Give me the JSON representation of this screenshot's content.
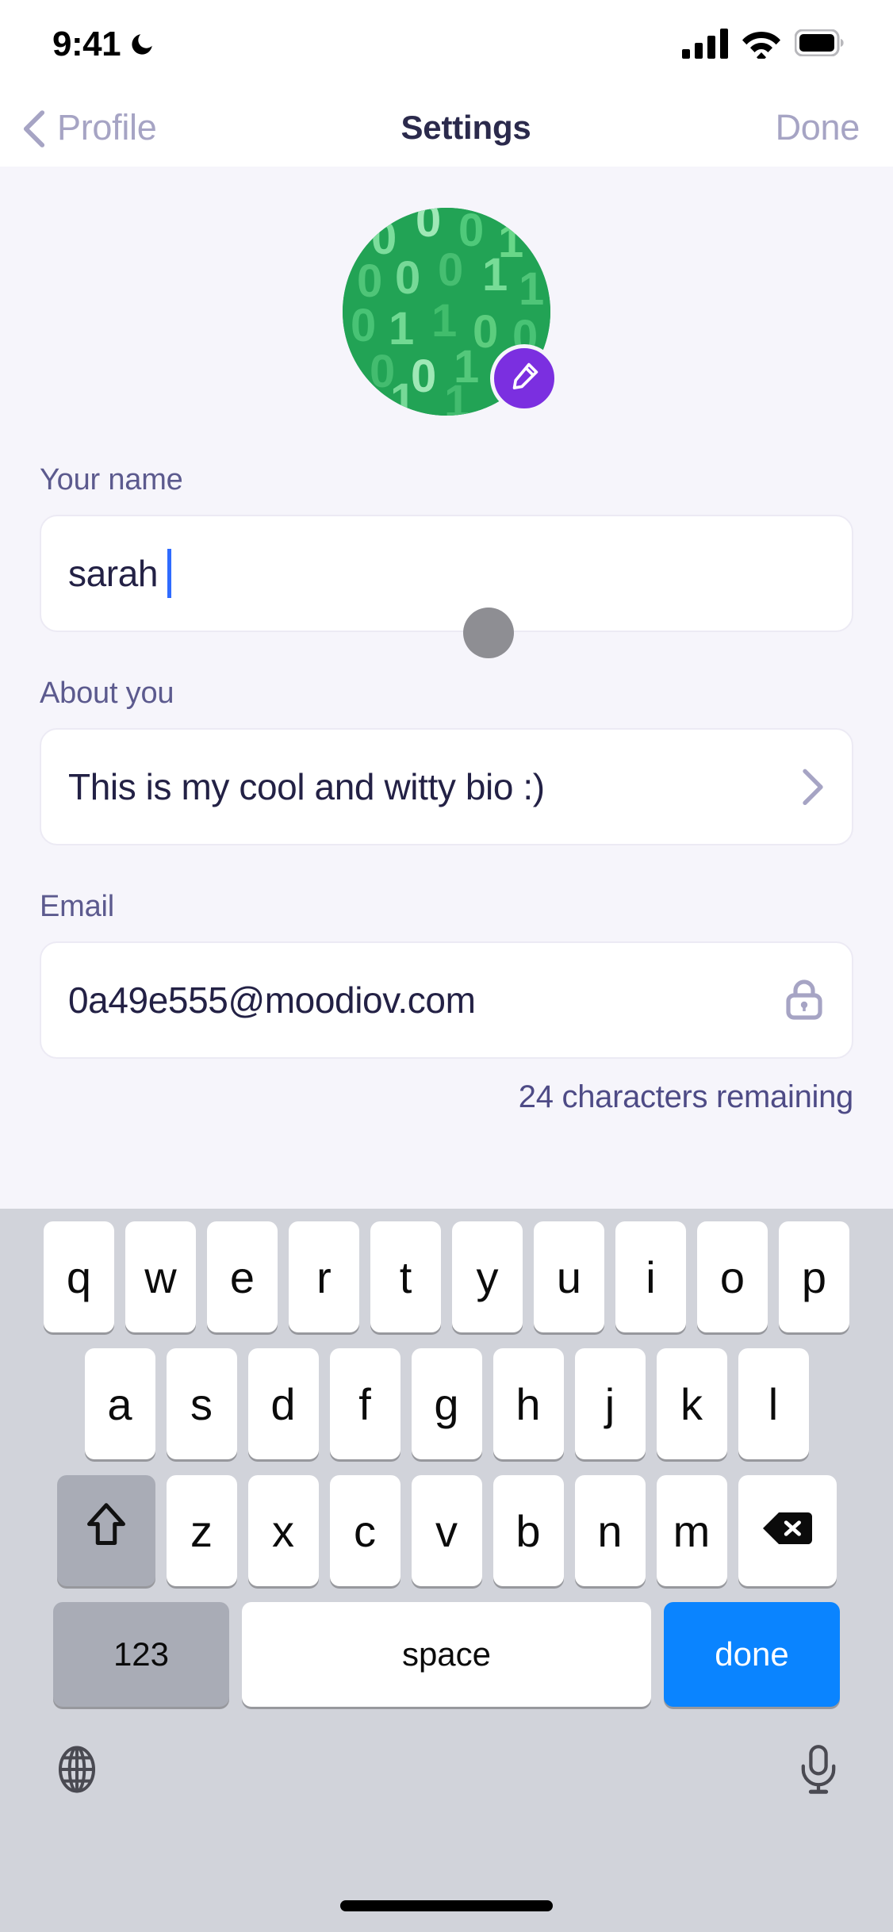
{
  "status_bar": {
    "time": "9:41",
    "icons": [
      "moon-icon",
      "cellular-signal-icon",
      "wifi-icon",
      "battery-icon"
    ]
  },
  "nav": {
    "back_label": "Profile",
    "title": "Settings",
    "done_label": "Done"
  },
  "avatar": {
    "alt": "binary-pattern-avatar",
    "background_color": "#22A355",
    "digit_color": "#7BE495",
    "digits": [
      "0",
      "0",
      "0",
      "1",
      "0",
      "0",
      "1",
      "0",
      "1",
      "1",
      "0",
      "1",
      "1",
      "0",
      "0",
      "1",
      "0",
      "1",
      "0",
      "1"
    ],
    "edit_badge_color": "#7B2FE0",
    "edit_icon": "pencil-icon"
  },
  "form": {
    "name": {
      "label": "Your name",
      "value": "sarah",
      "placeholder": "Your name"
    },
    "bio": {
      "label": "About you",
      "value": "This is my cool and witty bio :)",
      "chevron": "chevron-right-icon"
    },
    "email": {
      "label": "Email",
      "value": "0a49e555@moodiov.com",
      "lock_icon": "lock-icon",
      "hint": "24 characters remaining"
    }
  },
  "keyboard": {
    "row1": [
      "q",
      "w",
      "e",
      "r",
      "t",
      "y",
      "u",
      "i",
      "o",
      "p"
    ],
    "row2": [
      "a",
      "s",
      "d",
      "f",
      "g",
      "h",
      "j",
      "k",
      "l"
    ],
    "row3": [
      "z",
      "x",
      "c",
      "v",
      "b",
      "n",
      "m"
    ],
    "shift_icon": "shift-arrow-icon",
    "delete_icon": "backspace-icon",
    "numbers_label": "123",
    "space_label": "space",
    "done_label": "done",
    "globe_icon": "globe-icon",
    "mic_icon": "microphone-icon"
  },
  "colors": {
    "background": "#F6F5FB",
    "accent_purple": "#7B2FE0",
    "accent_blue": "#0A84FF",
    "text_dark": "#232145",
    "text_muted": "#5C5A8E",
    "keyboard_bg": "#D1D3DA"
  }
}
